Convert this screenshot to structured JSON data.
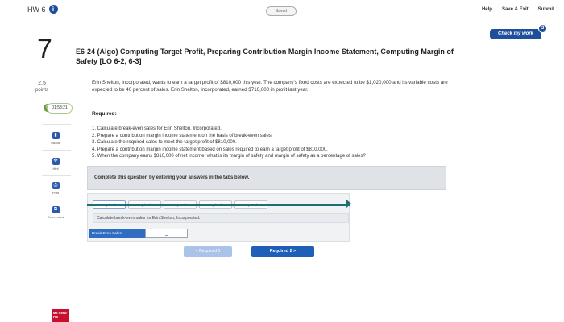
{
  "header": {
    "assignment": "HW 6",
    "info_icon": "info-icon",
    "saved": "Saved",
    "help": "Help",
    "save_exit": "Save & Exit",
    "submit": "Submit"
  },
  "check_work": {
    "label": "Check my work",
    "badge": "3"
  },
  "question": {
    "number": "7",
    "points_value": "2.5",
    "points_unit": "points",
    "timer": "01:58:21",
    "title": "E6-24 (Algo) Computing Target Profit, Preparing Contribution Margin Income Statement, Computing Margin of Safety [LO 6-2, 6-3]",
    "body": "Erin Shelton, Incorporated, wants to earn a target profit of $810,000 this year. The company's fixed costs are expected to be $1,020,000 and its variable costs are expected to be 40 percent of sales. Erin Shelton, Incorporated, earned $710,000 in profit last year.",
    "required_heading": "Required:",
    "requirements": [
      "1. Calculate break-even sales for Erin Shelton, Incorporated.",
      "2. Prepare a contribution margin income statement on the basis of break-even sales.",
      "3. Calculate the required sales to meet the target profit of $810,000.",
      "4. Prepare a contribution margin income statement based on sales required to earn a target profit of $810,000.",
      "5. When the company earns $810,000 of net income, what is its margin of safety and margin of safety as a percentage of sales?"
    ],
    "instruction": "Complete this question by entering your answers in the tabs below."
  },
  "rail": {
    "ebook": "eBook",
    "hint": "Hint",
    "print": "Print",
    "references": "References"
  },
  "tabs": [
    "Required 1",
    "Required 2",
    "Required 3",
    "Required 4",
    "Required 5"
  ],
  "tab_panel": {
    "prompt": "Calculate break-even sales for Erin Shelton, Incorporated.",
    "answer_label": "Break-Even Sales",
    "answer_value": ""
  },
  "navigation": {
    "prev": "< Required 1",
    "next": "Required 2  >"
  },
  "brand": {
    "logo_text": "Mc Graw Hill"
  }
}
